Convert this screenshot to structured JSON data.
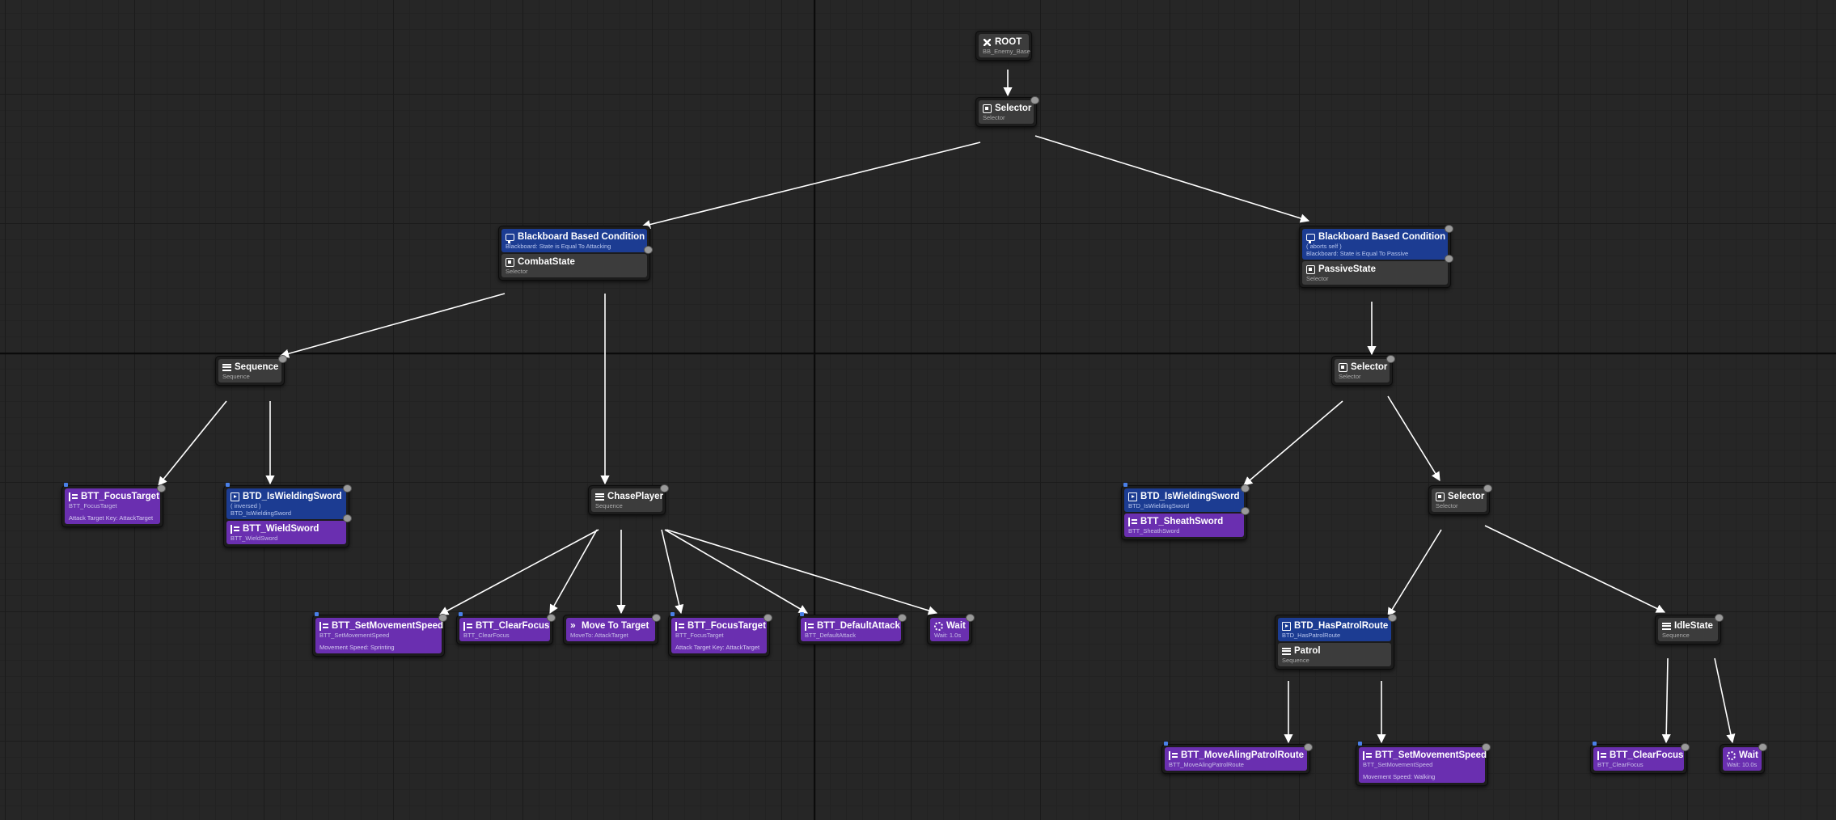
{
  "nodes": [
    {
      "id": "root",
      "title": "ROOT",
      "subtitle": "BB_Enemy_Base",
      "icon": "root-icon"
    },
    {
      "id": "top_selector",
      "title": "Selector",
      "subtitle": "Selector",
      "icon": "selector-icon"
    },
    {
      "id": "combat",
      "decorator": {
        "title": "Blackboard Based Condition",
        "subtitle": "Blackboard: State is Equal To Attacking",
        "icon": "blackboard-icon"
      },
      "title": "CombatState",
      "subtitle": "Selector",
      "icon": "selector-icon"
    },
    {
      "id": "passive",
      "decorator": {
        "title": "Blackboard Based Condition",
        "note": "( aborts self )",
        "subtitle": "Blackboard: State is Equal To Passive",
        "icon": "blackboard-icon"
      },
      "title": "PassiveState",
      "subtitle": "Selector",
      "icon": "selector-icon"
    },
    {
      "id": "sequence",
      "title": "Sequence",
      "subtitle": "Sequence",
      "icon": "sequence-icon"
    },
    {
      "id": "chase",
      "title": "ChasePlayer",
      "subtitle": "Sequence",
      "icon": "sequence-icon"
    },
    {
      "id": "focus1",
      "title": "BTT_FocusTarget",
      "subtitle": "BTT_FocusTarget",
      "prop": "Attack Target Key: AttackTarget",
      "icon": "task-icon"
    },
    {
      "id": "wield",
      "decorator": {
        "title": "BTD_IsWieldingSword",
        "note": "( inversed )",
        "subtitle": "BTD_IsWieldingSword",
        "icon": "decorator-icon"
      },
      "title": "BTT_WieldSword",
      "subtitle": "BTT_WieldSword",
      "icon": "task-icon"
    },
    {
      "id": "setspeed1",
      "title": "BTT_SetMovementSpeed",
      "subtitle": "BTT_SetMovementSpeed",
      "prop": "Movement Speed: Sprinting",
      "icon": "task-icon"
    },
    {
      "id": "clearfocus1",
      "title": "BTT_ClearFocus",
      "subtitle": "BTT_ClearFocus",
      "icon": "task-icon"
    },
    {
      "id": "moveto",
      "title": "Move To Target",
      "subtitle": "MoveTo: AttackTarget",
      "icon": "move-icon"
    },
    {
      "id": "focus2",
      "title": "BTT_FocusTarget",
      "subtitle": "BTT_FocusTarget",
      "prop": "Attack Target Key: AttackTarget",
      "icon": "task-icon"
    },
    {
      "id": "attack",
      "title": "BTT_DefaultAttack",
      "subtitle": "BTT_DefaultAttack",
      "icon": "task-icon"
    },
    {
      "id": "wait1",
      "title": "Wait",
      "subtitle": "Wait: 1.0s",
      "icon": "wait-icon"
    },
    {
      "id": "selector2",
      "title": "Selector",
      "subtitle": "Selector",
      "icon": "selector-icon"
    },
    {
      "id": "sheath",
      "decorator": {
        "title": "BTD_IsWieldingSword",
        "subtitle": "BTD_IsWieldingSword",
        "icon": "decorator-icon"
      },
      "title": "BTT_SheathSword",
      "subtitle": "BTT_SheathSword",
      "icon": "task-icon"
    },
    {
      "id": "selector3",
      "title": "Selector",
      "subtitle": "Selector",
      "icon": "selector-icon"
    },
    {
      "id": "patrol",
      "decorator": {
        "title": "BTD_HasPatrolRoute",
        "subtitle": "BTD_HasPatrolRoute",
        "icon": "decorator-icon"
      },
      "title": "Patrol",
      "subtitle": "Sequence",
      "icon": "sequence-icon"
    },
    {
      "id": "idle",
      "title": "IdleState",
      "subtitle": "Sequence",
      "icon": "sequence-icon"
    },
    {
      "id": "moveroute",
      "title": "BTT_MoveAlingPatrolRoute",
      "subtitle": "BTT_MoveAlingPatrolRoute",
      "icon": "task-icon"
    },
    {
      "id": "setspeed2",
      "title": "BTT_SetMovementSpeed",
      "subtitle": "BTT_SetMovementSpeed",
      "prop": "Movement Speed: Walking",
      "icon": "task-icon"
    },
    {
      "id": "clearfocus2",
      "title": "BTT_ClearFocus",
      "subtitle": "BTT_ClearFocus",
      "icon": "task-icon"
    },
    {
      "id": "wait2",
      "title": "Wait",
      "subtitle": "Wait: 10.0s",
      "icon": "wait-icon"
    }
  ],
  "edges": [
    [
      "root",
      "top_selector"
    ],
    [
      "top_selector",
      "combat"
    ],
    [
      "top_selector",
      "passive"
    ],
    [
      "combat",
      "sequence"
    ],
    [
      "combat",
      "chase"
    ],
    [
      "sequence",
      "focus1"
    ],
    [
      "sequence",
      "wield"
    ],
    [
      "chase",
      "setspeed1"
    ],
    [
      "chase",
      "clearfocus1"
    ],
    [
      "chase",
      "moveto"
    ],
    [
      "chase",
      "focus2"
    ],
    [
      "chase",
      "attack"
    ],
    [
      "chase",
      "wait1"
    ],
    [
      "passive",
      "selector2"
    ],
    [
      "selector2",
      "sheath"
    ],
    [
      "selector2",
      "selector3"
    ],
    [
      "selector3",
      "patrol"
    ],
    [
      "selector3",
      "idle"
    ],
    [
      "patrol",
      "moveroute"
    ],
    [
      "patrol",
      "setspeed2"
    ],
    [
      "idle",
      "clearfocus2"
    ],
    [
      "idle",
      "wait2"
    ]
  ]
}
